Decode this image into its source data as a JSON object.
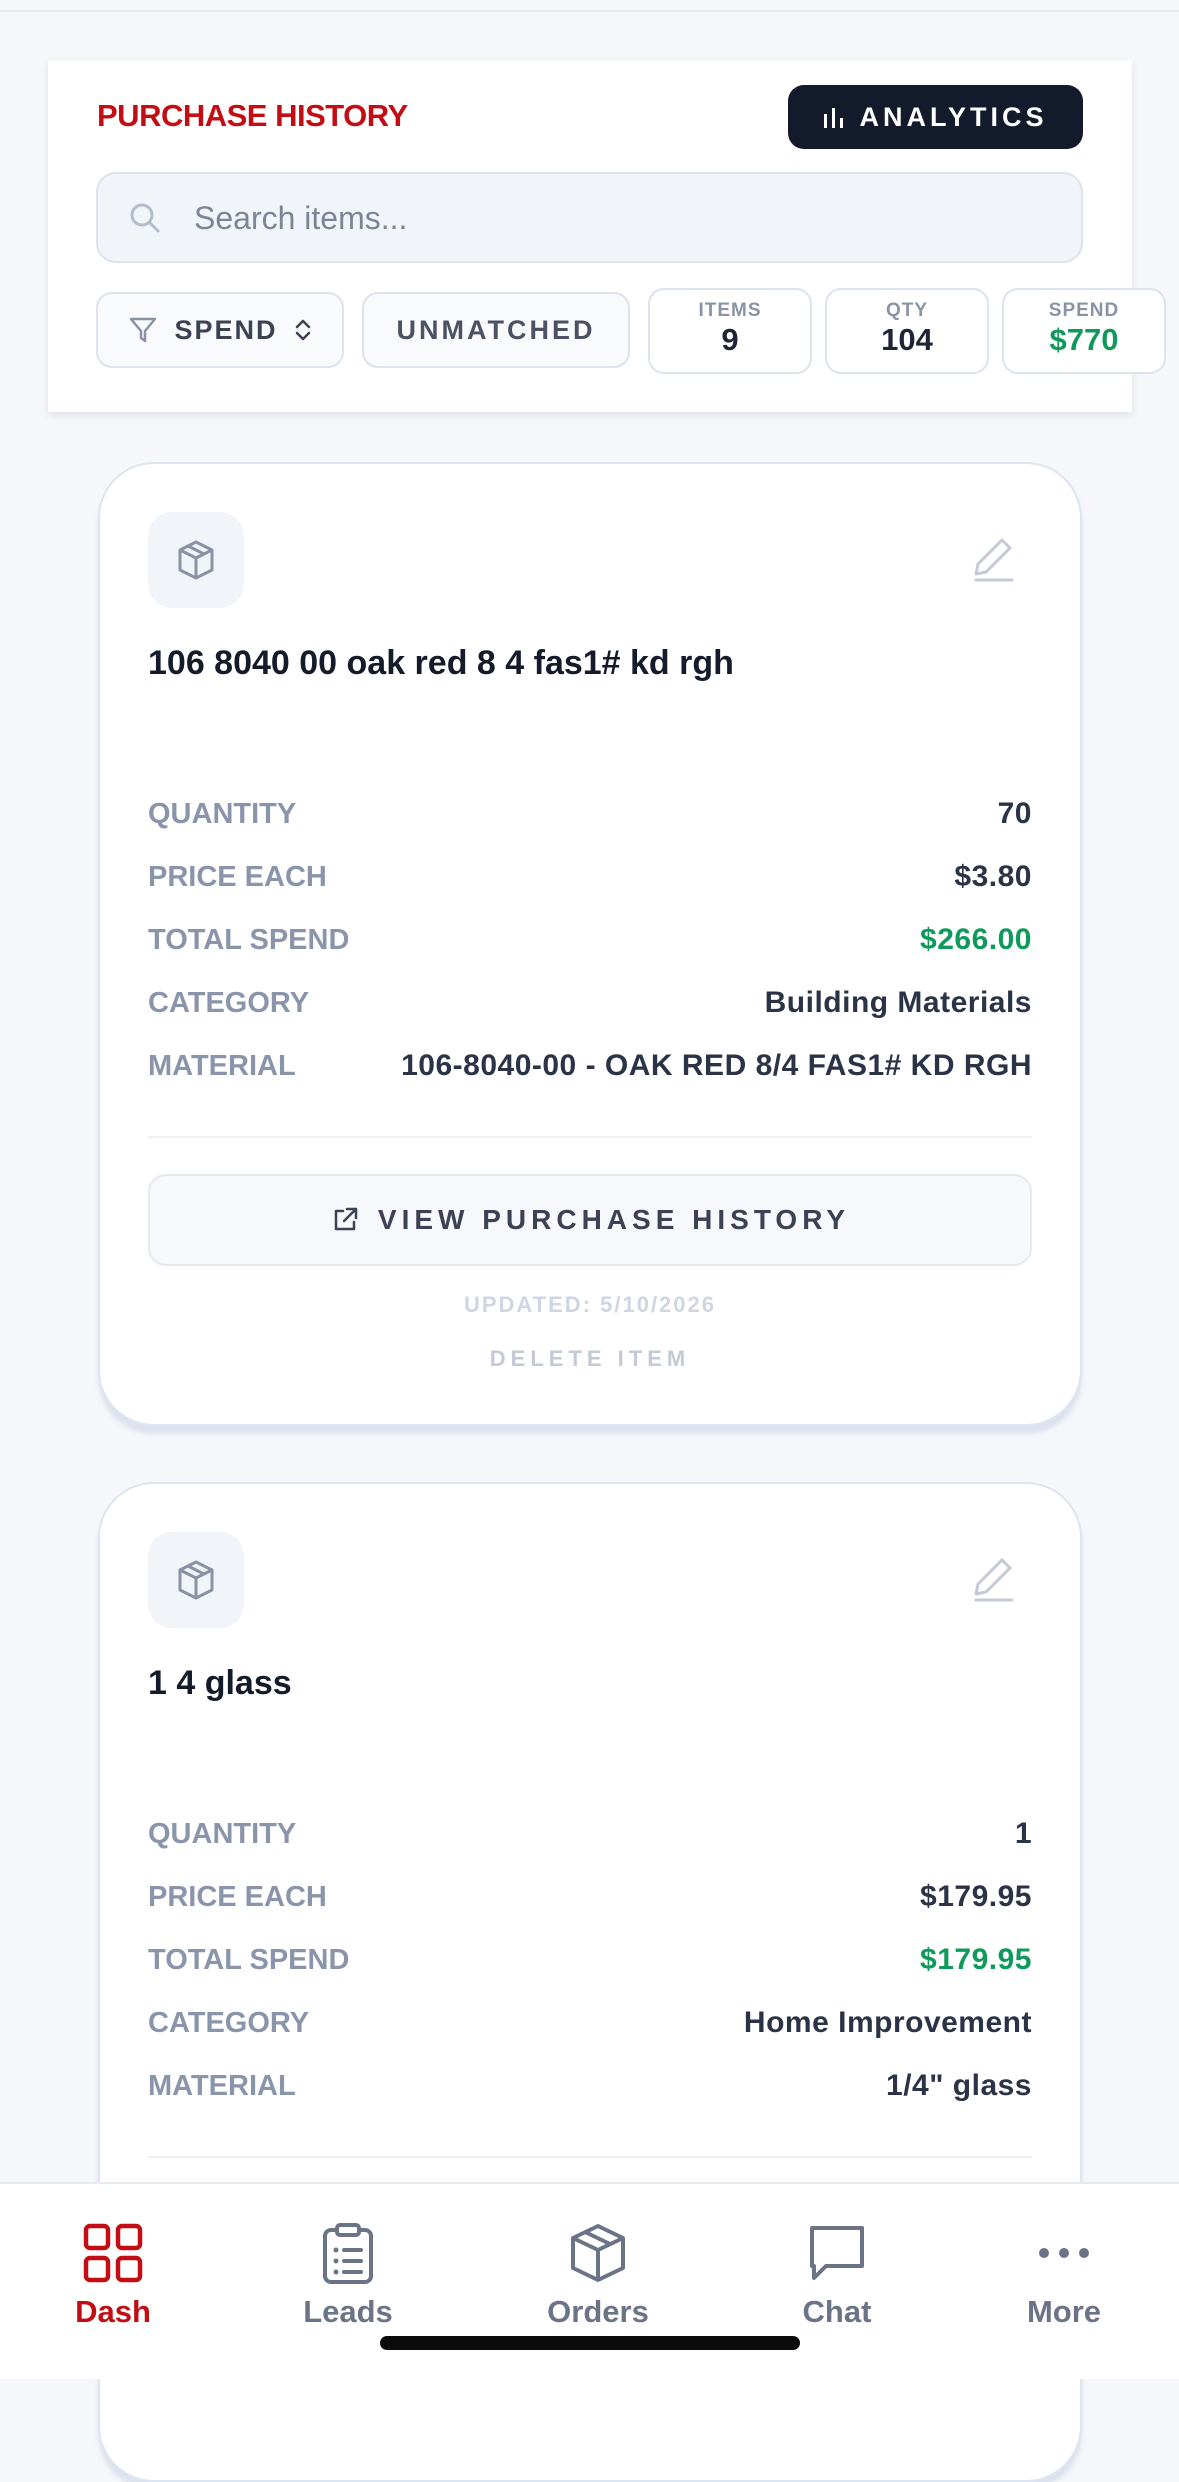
{
  "header": {
    "title": "PURCHASE HISTORY",
    "analytics_label": "ANALYTICS",
    "search_placeholder": "Search items..."
  },
  "filters": {
    "sort_label": "SPEND",
    "unmatched_label": "UNMATCHED"
  },
  "stats": [
    {
      "label": "ITEMS",
      "value": "9"
    },
    {
      "label": "QTY",
      "value": "104"
    },
    {
      "label": "SPEND",
      "value": "$770"
    }
  ],
  "items": [
    {
      "title": "106 8040 00 oak red 8 4 fas1# kd rgh",
      "rows": [
        {
          "label": "QUANTITY",
          "value": "70"
        },
        {
          "label": "PRICE EACH",
          "value": "$3.80"
        },
        {
          "label": "TOTAL SPEND",
          "value": "$266.00"
        },
        {
          "label": "CATEGORY",
          "value": "Building Materials"
        },
        {
          "label": "MATERIAL",
          "value": "106-8040-00 - OAK RED 8/4 FAS1# KD RGH"
        }
      ],
      "view_label": "VIEW PURCHASE HISTORY",
      "updated": "UPDATED: 5/10/2026",
      "delete_label": "DELETE ITEM"
    },
    {
      "title": "1 4 glass",
      "rows": [
        {
          "label": "QUANTITY",
          "value": "1"
        },
        {
          "label": "PRICE EACH",
          "value": "$179.95"
        },
        {
          "label": "TOTAL SPEND",
          "value": "$179.95"
        },
        {
          "label": "CATEGORY",
          "value": "Home Improvement"
        },
        {
          "label": "MATERIAL",
          "value": "1/4\" glass"
        }
      ]
    }
  ],
  "nav": [
    {
      "label": "Dash",
      "icon": "grid-icon",
      "active": true
    },
    {
      "label": "Leads",
      "icon": "clipboard-icon"
    },
    {
      "label": "Orders",
      "icon": "box-icon"
    },
    {
      "label": "Chat",
      "icon": "chat-icon"
    },
    {
      "label": "More",
      "icon": "more-icon"
    }
  ],
  "colors": {
    "accent": "#c30d15",
    "positive": "#0f9a5c",
    "dark_button": "#131a2b"
  }
}
